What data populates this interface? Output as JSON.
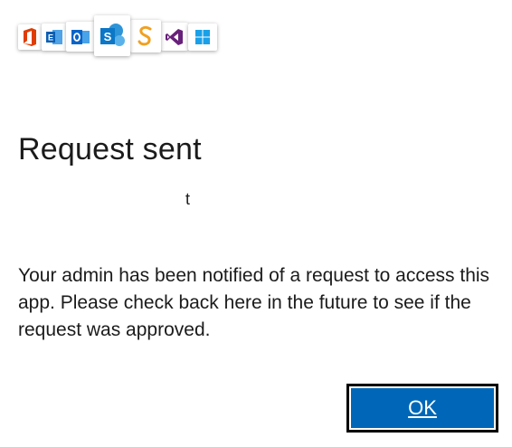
{
  "app_icons": [
    {
      "name": "office-icon",
      "color": "#e03c00"
    },
    {
      "name": "exchange-icon",
      "color": "#0a5fb4"
    },
    {
      "name": "outlook-icon",
      "color": "#0a64c8"
    },
    {
      "name": "sharepoint-icon",
      "color": "#0b77c6"
    },
    {
      "name": "swagger-icon",
      "color": "#f0a020"
    },
    {
      "name": "visual-studio-icon",
      "color": "#68217a"
    },
    {
      "name": "windows-icon",
      "color": "#1aa0e8"
    }
  ],
  "dialog": {
    "title": "Request sent",
    "account_line_1": "t",
    "message": "Your admin has been notified of a request to access this app. Please check back here in the future to see if the request was approved.",
    "ok_label": "OK"
  },
  "colors": {
    "accent": "#0067b8",
    "text": "#1b1b1b",
    "background": "#ffffff"
  }
}
